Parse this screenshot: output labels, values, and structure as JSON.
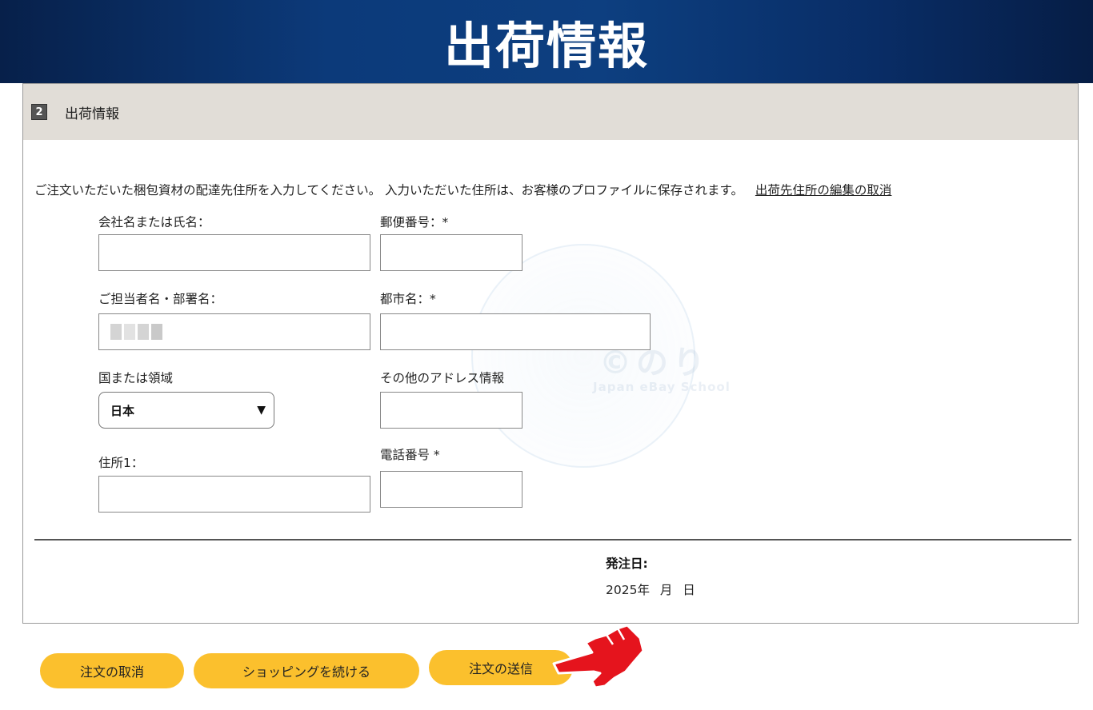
{
  "banner": {
    "title": "出荷情報"
  },
  "panel": {
    "step_number": "2",
    "header_title": "出荷情報",
    "intro_text": "ご注文いただいた梱包資材の配達先住所を入力してください。 入力いただいた住所は、お客様のプロファイルに保存されます。",
    "cancel_edit_link": "出荷先住所の編集の取消"
  },
  "form": {
    "company_label": "会社名または氏名：",
    "company_value": "",
    "postal_label": "郵便番号：*",
    "postal_value": "",
    "contact_label": "ご担当者名・部署名：",
    "city_label": "都市名：*",
    "city_value": "",
    "country_label": "国または領域",
    "country_value": "日本",
    "other_address_label": "その他のアドレス情報",
    "other_address_value": "",
    "address1_label": "住所1：",
    "address1_value": "",
    "phone_label": "電話番号 *",
    "phone_value": ""
  },
  "order_date": {
    "label": "発注日:",
    "value": "2025年 月 日"
  },
  "watermark": {
    "text": "©のり",
    "sub": "Japan eBay School"
  },
  "buttons": {
    "cancel_order": "注文の取消",
    "continue_shopping": "ショッピングを続ける",
    "submit_order": "注文の送信"
  },
  "colors": {
    "banner_dark": "#07204a",
    "banner_mid": "#0d3f80",
    "header_bg": "#e1ddd7",
    "button_yellow": "#fbc02d",
    "pointer_red": "#e5141d"
  }
}
